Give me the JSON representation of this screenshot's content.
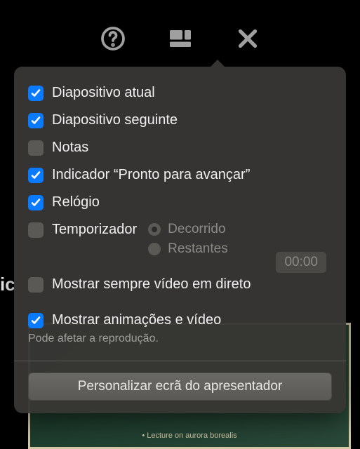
{
  "toolbar": {
    "help_icon": "help",
    "layout_icon": "layout",
    "close_icon": "close"
  },
  "options": {
    "current_slide": {
      "label": "Diapositivo atual",
      "checked": true
    },
    "next_slide": {
      "label": "Diapositivo seguinte",
      "checked": true
    },
    "notes": {
      "label": "Notas",
      "checked": false
    },
    "ready_indicator": {
      "label": "Indicador “Pronto para avançar”",
      "checked": true
    },
    "clock": {
      "label": "Relógio",
      "checked": true
    },
    "timer": {
      "label": "Temporizador",
      "checked": false,
      "radios": {
        "elapsed": {
          "label": "Decorrido",
          "selected": true
        },
        "remaining": {
          "label": "Restantes",
          "selected": false
        }
      },
      "time_value": "00:00"
    },
    "always_live_video": {
      "label": "Mostrar sempre vídeo em direto",
      "checked": false
    },
    "show_animations": {
      "label": "Mostrar animações e vídeo",
      "checked": true
    },
    "show_animations_help": "Pode afetar a reprodução."
  },
  "customize_button": "Personalizar ecrã do apresentador",
  "bg_text": "ic",
  "bg_slide_caption": "• Lecture on aurora borealis"
}
